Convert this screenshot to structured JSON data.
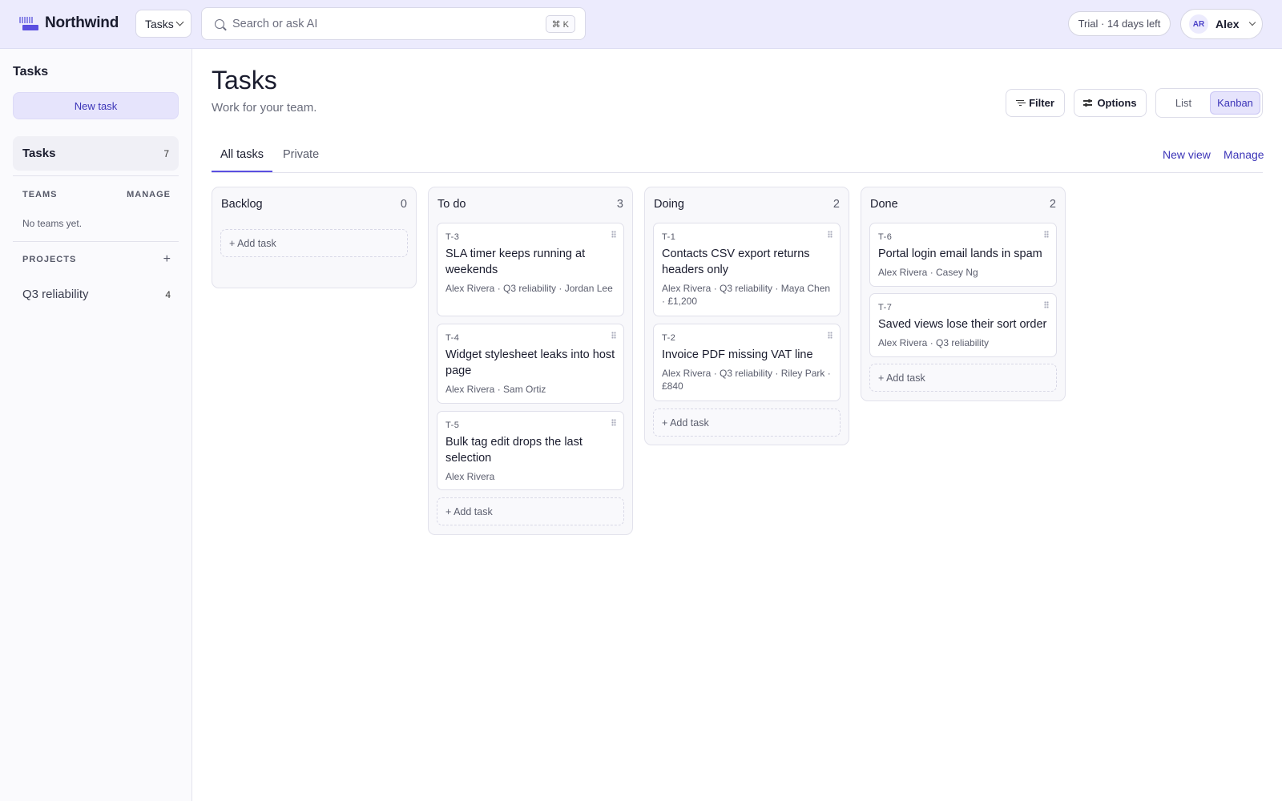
{
  "app": {
    "brand": "Northwind",
    "module": "Tasks",
    "search_placeholder": "Search or ask AI",
    "search_shortcut": "⌘ K",
    "trial": "Trial · 14 days left",
    "user_initials": "AR",
    "user_name": "Alex"
  },
  "sidebar": {
    "title": "Tasks",
    "new_task": "New task",
    "nav_tasks_label": "Tasks",
    "nav_tasks_count": "7",
    "teams_heading": "TEAMS",
    "teams_manage": "MANAGE",
    "no_teams": "No teams yet.",
    "projects_heading": "PROJECTS",
    "projects_add": "+",
    "projects": [
      {
        "label": "Q3 reliability",
        "count": "4"
      }
    ]
  },
  "main": {
    "title": "Tasks",
    "subtitle": "Work for your team.",
    "filter_label": "Filter",
    "options_label": "Options",
    "view_list": "List",
    "view_kanban": "Kanban",
    "tabs": [
      {
        "label": "All tasks",
        "active": true
      },
      {
        "label": "Private",
        "active": false
      }
    ],
    "new_view": "New view",
    "manage": "Manage"
  },
  "board": {
    "add_task_label": "+ Add task",
    "columns": [
      {
        "title": "Backlog",
        "count": "0",
        "cards": []
      },
      {
        "title": "To do",
        "count": "3",
        "cards": [
          {
            "id": "T-3",
            "title": "SLA timer keeps running at weekends",
            "meta": "Alex Rivera · Q3 reliability · Jordan Lee"
          },
          {
            "id": "T-4",
            "title": "Widget stylesheet leaks into host page",
            "meta": "Alex Rivera · Sam Ortiz"
          },
          {
            "id": "T-5",
            "title": "Bulk tag edit drops the last selection",
            "meta": "Alex Rivera"
          }
        ]
      },
      {
        "title": "Doing",
        "count": "2",
        "cards": [
          {
            "id": "T-1",
            "title": "Contacts CSV export returns headers only",
            "meta": "Alex Rivera · Q3 reliability · Maya Chen · £1,200"
          },
          {
            "id": "T-2",
            "title": "Invoice PDF missing VAT line",
            "meta": "Alex Rivera · Q3 reliability · Riley Park · £840"
          }
        ]
      },
      {
        "title": "Done",
        "count": "2",
        "cards": [
          {
            "id": "T-6",
            "title": "Portal login email lands in spam",
            "meta": "Alex Rivera · Casey Ng"
          },
          {
            "id": "T-7",
            "title": "Saved views lose their sort order",
            "meta": "Alex Rivera · Q3 reliability"
          }
        ]
      }
    ]
  },
  "colors": {
    "accent": "#5a4fe0",
    "accent_text": "#3c35b8",
    "topbar_bg": "#ecebfd"
  }
}
